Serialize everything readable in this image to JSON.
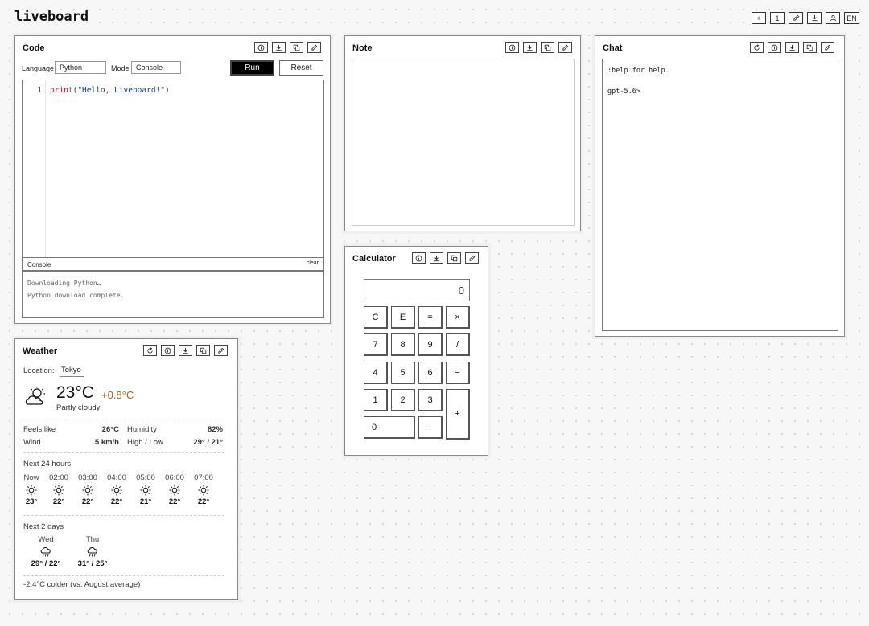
{
  "app": {
    "name": "liveboard"
  },
  "topbar": [
    "+",
    "1",
    "edit-icon",
    "download-icon",
    "user-icon",
    "EN"
  ],
  "topbar_labels": {
    "add": "+",
    "one": "1",
    "lang": "EN"
  },
  "code": {
    "title": "Code",
    "language_label": "Language",
    "language_value": "Python",
    "mode_label": "Mode",
    "mode_value": "Console",
    "run": "Run",
    "reset": "Reset",
    "line_no": "1",
    "code_kw": "print",
    "code_rest": "(\"Hello, Liveboard!\")",
    "console_label": "Console",
    "clear": "clear",
    "console_lines": [
      "Downloading Python…",
      "Python download complete."
    ]
  },
  "note": {
    "title": "Note"
  },
  "chat": {
    "title": "Chat",
    "line1": ":help for help.",
    "line2": "gpt-5.6>"
  },
  "calc": {
    "title": "Calculator",
    "display": "0",
    "keys": [
      "C",
      "E",
      "=",
      "×",
      "7",
      "8",
      "9",
      "/",
      "4",
      "5",
      "6",
      "−",
      "1",
      "2",
      "3",
      "+",
      "0",
      "."
    ]
  },
  "weather": {
    "title": "Weather",
    "location_label": "Location:",
    "location": "Tokyo",
    "temp": "23°C",
    "delta": "+0.8°C",
    "condition": "Partly cloudy",
    "feels_label": "Feels like",
    "feels": "26°C",
    "humidity_label": "Humidity",
    "humidity": "82%",
    "wind_label": "Wind",
    "wind": "5 km/h",
    "highlow_label": "High / Low",
    "highlow": "29° / 21°",
    "next24_label": "Next 24 hours",
    "hours": [
      {
        "t": "Now",
        "v": "23°"
      },
      {
        "t": "02:00",
        "v": "22°"
      },
      {
        "t": "03:00",
        "v": "22°"
      },
      {
        "t": "04:00",
        "v": "22°"
      },
      {
        "t": "05:00",
        "v": "21°"
      },
      {
        "t": "06:00",
        "v": "22°"
      },
      {
        "t": "07:00",
        "v": "22°"
      }
    ],
    "next2_label": "Next 2 days",
    "days": [
      {
        "d": "Wed",
        "v": "29° / 22°"
      },
      {
        "d": "Thu",
        "v": "31° / 25°"
      }
    ],
    "footer": "-2.4°C colder (vs. August average)"
  },
  "colors": {
    "delta": "#a0660a",
    "code_keyword": "#b5173a",
    "code_string": "#1a3a7a"
  }
}
